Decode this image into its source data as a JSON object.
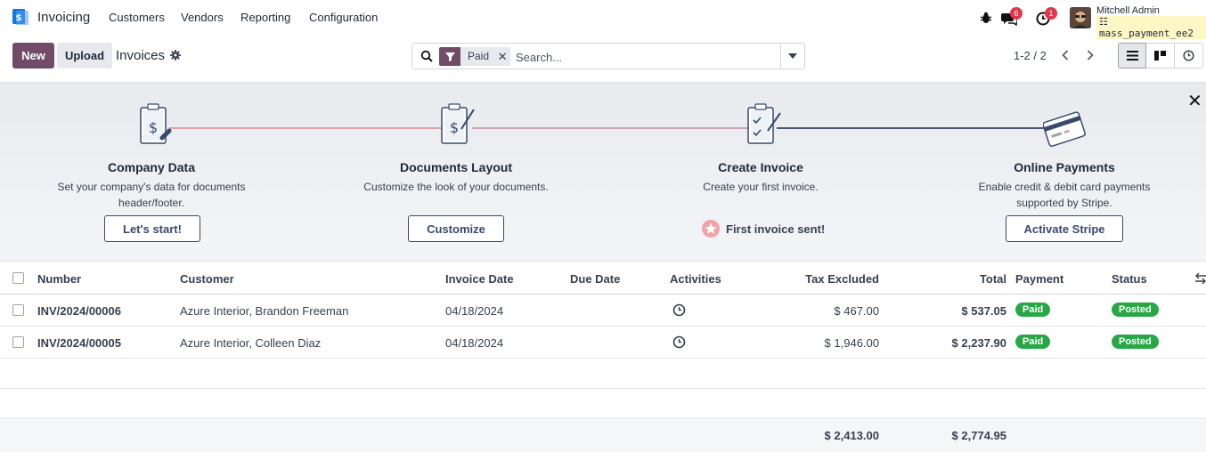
{
  "navbar": {
    "app_name": "Invoicing",
    "menu": [
      "Customers",
      "Vendors",
      "Reporting",
      "Configuration"
    ],
    "messages_count": "6",
    "activities_count": "1",
    "user_name": "Mitchell Admin",
    "database": "mass_payment_ee2"
  },
  "control_panel": {
    "new_label": "New",
    "upload_label": "Upload",
    "title": "Invoices",
    "search": {
      "facet_label": "Paid",
      "facet_remove": "✕",
      "placeholder": "Search..."
    },
    "pager": "1-2 / 2"
  },
  "onboarding": {
    "close": "✕",
    "steps": [
      {
        "title": "Company Data",
        "desc_line1": "Set your company's data for documents",
        "desc_line2": "header/footer.",
        "button": "Let's start!"
      },
      {
        "title": "Documents Layout",
        "desc_line1": "Customize the look of your documents.",
        "button": "Customize"
      },
      {
        "title": "Create Invoice",
        "desc_line1": "Create your first invoice.",
        "done_label": "First invoice sent!"
      },
      {
        "title": "Online Payments",
        "desc_line1": "Enable credit & debit card payments",
        "desc_line2": "supported by Stripe.",
        "button": "Activate Stripe"
      }
    ]
  },
  "table": {
    "columns": [
      "Number",
      "Customer",
      "Invoice Date",
      "Due Date",
      "Activities",
      "Tax Excluded",
      "Total",
      "Payment",
      "Status"
    ],
    "rows": [
      {
        "number": "INV/2024/00006",
        "customer": "Azure Interior, Brandon Freeman",
        "invoice_date": "04/18/2024",
        "due_date": "",
        "tax_excluded": "$ 467.00",
        "total": "$ 537.05",
        "payment": "Paid",
        "status": "Posted"
      },
      {
        "number": "INV/2024/00005",
        "customer": "Azure Interior, Colleen Diaz",
        "invoice_date": "04/18/2024",
        "due_date": "",
        "tax_excluded": "$ 1,946.00",
        "total": "$ 2,237.90",
        "payment": "Paid",
        "status": "Posted"
      }
    ],
    "totals": {
      "tax_excluded": "$ 2,413.00",
      "total": "$ 2,774.95"
    }
  },
  "colors": {
    "brand": "#714b67",
    "paid_badge": "#28a745",
    "notification": "#e0354b"
  }
}
